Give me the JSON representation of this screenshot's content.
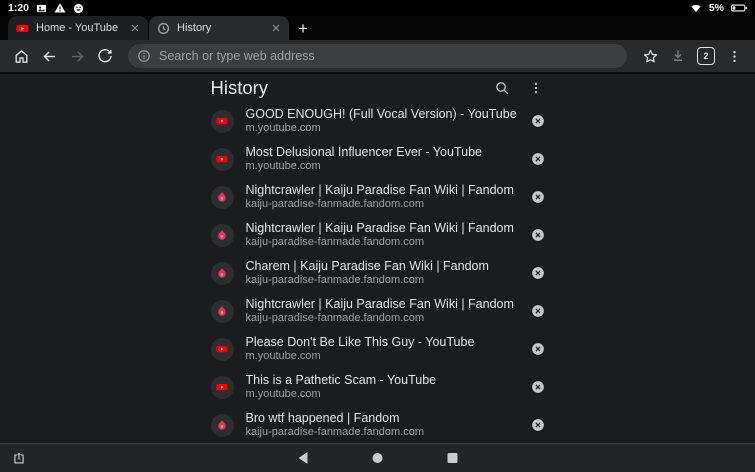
{
  "status_bar": {
    "time": "1:20",
    "battery_percent": "5%",
    "left_icons": [
      "screenshot-thumbnail",
      "warning",
      "smiley"
    ],
    "right_icons": [
      "wifi",
      "battery"
    ]
  },
  "tab_bar": {
    "tabs": [
      {
        "title": "Home - YouTube",
        "favicon": "youtube",
        "active": false
      },
      {
        "title": "History",
        "favicon": "history-clock",
        "active": true
      }
    ],
    "new_tab_label": "+"
  },
  "toolbar": {
    "omnibox_placeholder": "Search or type web address",
    "tab_count": "2",
    "icons": [
      "home",
      "back",
      "forward",
      "refresh",
      "info",
      "star",
      "download",
      "tab-switcher",
      "menu"
    ]
  },
  "history_page": {
    "title": "History",
    "header_icons": [
      "search",
      "more-menu"
    ],
    "items": [
      {
        "title": "GOOD ENOUGH! (Full Vocal Version) - YouTube",
        "url": "m.youtube.com",
        "favicon": "youtube"
      },
      {
        "title": "Most Delusional Influencer Ever - YouTube",
        "url": "m.youtube.com",
        "favicon": "youtube"
      },
      {
        "title": "Nightcrawler | Kaiju Paradise Fan Wiki | Fandom",
        "url": "kaiju-paradise-fanmade.fandom.com",
        "favicon": "fandom"
      },
      {
        "title": "Nightcrawler | Kaiju Paradise Fan Wiki | Fandom",
        "url": "kaiju-paradise-fanmade.fandom.com",
        "favicon": "fandom"
      },
      {
        "title": "Charem | Kaiju Paradise Fan Wiki | Fandom",
        "url": "kaiju-paradise-fanmade.fandom.com",
        "favicon": "fandom"
      },
      {
        "title": "Nightcrawler | Kaiju Paradise Fan Wiki | Fandom",
        "url": "kaiju-paradise-fanmade.fandom.com",
        "favicon": "fandom"
      },
      {
        "title": "Please Don't Be Like This Guy - YouTube",
        "url": "m.youtube.com",
        "favicon": "youtube"
      },
      {
        "title": "This is a Pathetic Scam - YouTube",
        "url": "m.youtube.com",
        "favicon": "youtube"
      },
      {
        "title": "Bro wtf happened | Fandom",
        "url": "kaiju-paradise-fanmade.fandom.com",
        "favicon": "fandom"
      }
    ]
  },
  "nav_bar": {
    "icons": [
      "share",
      "back",
      "home",
      "recents"
    ]
  },
  "colors": {
    "youtube_red": "#f60002",
    "fandom_flame": "#e8354d",
    "toolbar_bg": "#292a2d",
    "content_bg": "#1b1c1d",
    "text_primary": "#e8eaed",
    "text_secondary": "#9aa0a6"
  }
}
